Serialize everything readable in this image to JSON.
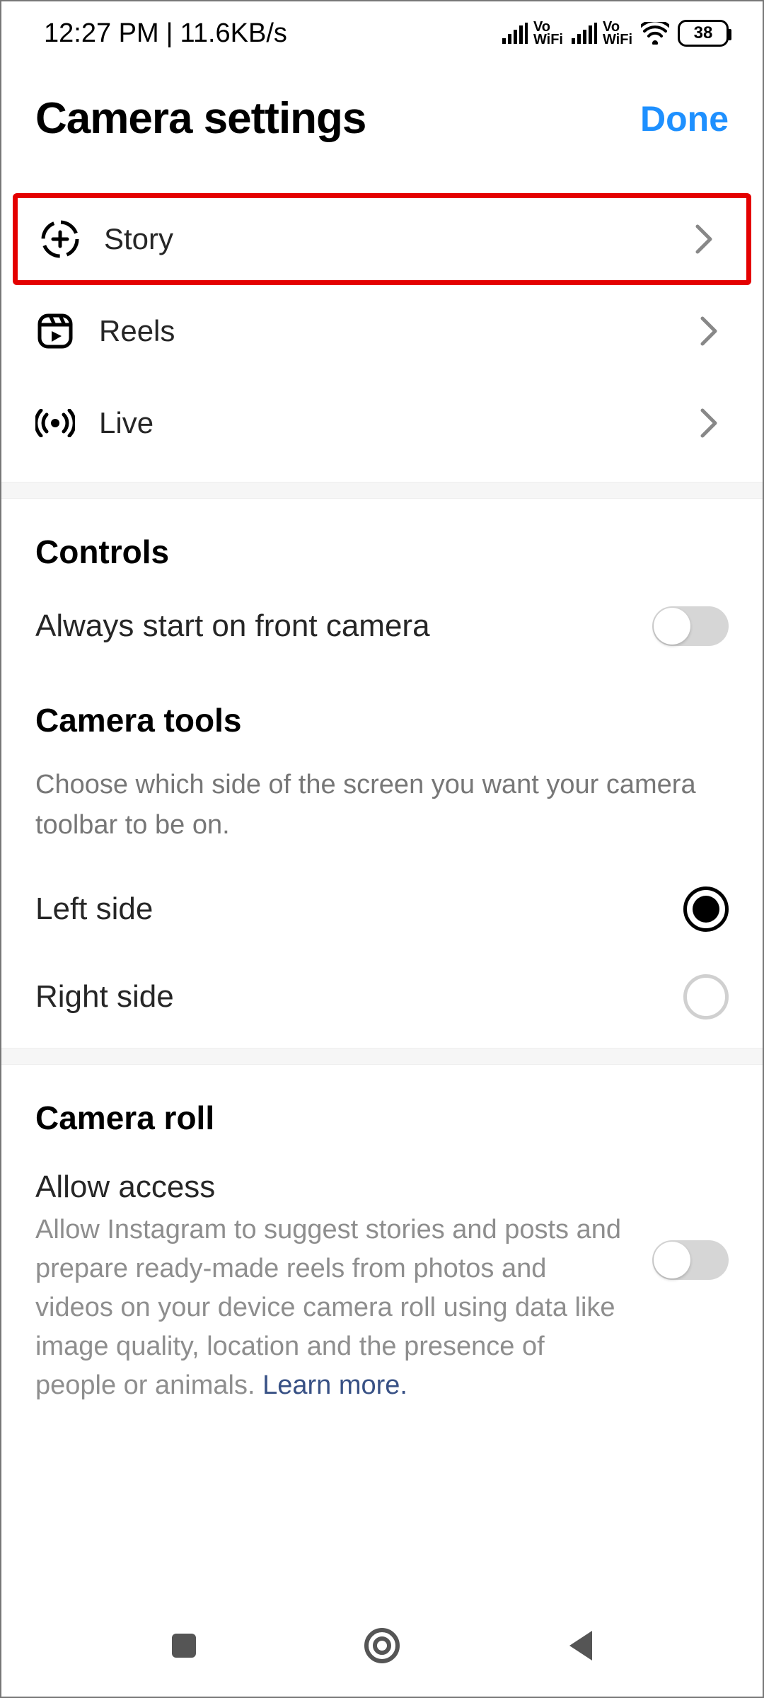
{
  "status": {
    "time": "12:27 PM",
    "separator": "|",
    "speed": "11.6KB/s",
    "vowifi": "Vo WiFi",
    "battery": "38"
  },
  "header": {
    "title": "Camera settings",
    "done": "Done"
  },
  "nav": {
    "story": "Story",
    "reels": "Reels",
    "live": "Live"
  },
  "controls": {
    "title": "Controls",
    "front_camera": "Always start on front camera"
  },
  "tools": {
    "title": "Camera tools",
    "desc": "Choose which side of the screen you want your camera toolbar to be on.",
    "left": "Left side",
    "right": "Right side"
  },
  "roll": {
    "title": "Camera roll",
    "allow_title": "Allow access",
    "allow_desc": "Allow Instagram to suggest stories and posts and prepare ready-made reels from photos and videos on your device camera roll using data like image quality, location and the presence of people or animals. ",
    "learn_more": "Learn more."
  }
}
